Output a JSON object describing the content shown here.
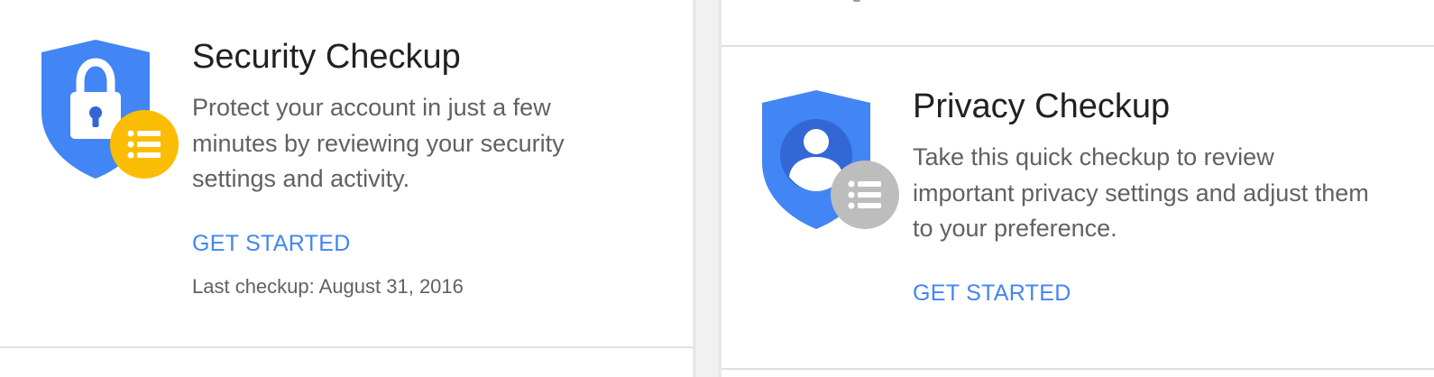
{
  "security_card": {
    "title": "Security Checkup",
    "description": "Protect your account in just a few minutes by reviewing your security settings and activity.",
    "cta_label": "GET STARTED",
    "last_checkup": "Last checkup: August 31, 2016",
    "icon": "shield-lock-icon",
    "badge_icon": "list-icon",
    "badge_color": "#fbbc04"
  },
  "privacy_card": {
    "title": "Privacy Checkup",
    "description": "Take this quick checkup to review important privacy settings and adjust them to your preference.",
    "cta_label": "GET STARTED",
    "icon": "shield-person-icon",
    "badge_icon": "list-icon",
    "badge_color": "#bdbdbd"
  },
  "colors": {
    "accent": "#4285f4",
    "shield": "#4285f4",
    "shield_dark": "#3367d6"
  }
}
